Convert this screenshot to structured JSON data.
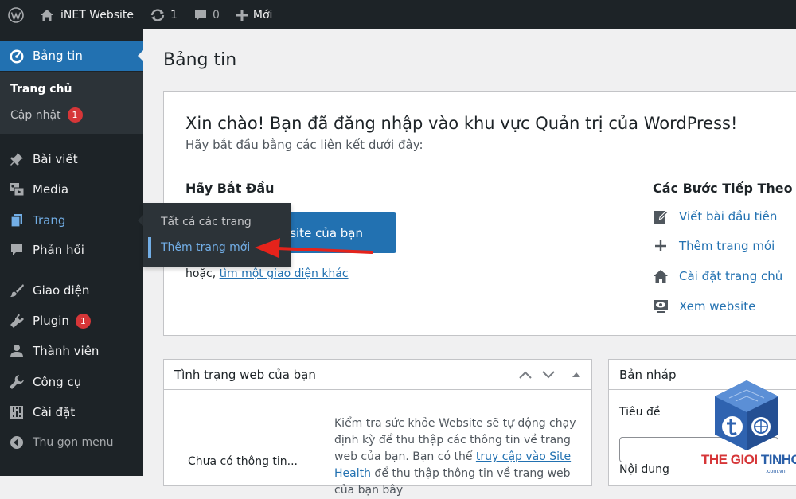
{
  "admin_bar": {
    "site_name": "iNET Website",
    "updates_count": "1",
    "comments_count": "0",
    "new_label": "Mới",
    "icons": [
      "wordpress-logo-icon",
      "home-icon",
      "refresh-icon",
      "comment-icon",
      "plus-icon"
    ]
  },
  "sidebar": {
    "dashboard": "Bảng tin",
    "submenu": {
      "home": "Trang chủ",
      "updates": "Cập nhật",
      "updates_badge": "1"
    },
    "items": [
      {
        "label": "Bài viết",
        "icon": "pin-icon"
      },
      {
        "label": "Media",
        "icon": "media-icon"
      },
      {
        "label": "Trang",
        "icon": "pages-icon"
      },
      {
        "label": "Phản hồi",
        "icon": "comment-icon"
      },
      {
        "label": "Giao diện",
        "icon": "brush-icon"
      },
      {
        "label": "Plugin",
        "icon": "plugin-icon",
        "badge": "1"
      },
      {
        "label": "Thành viên",
        "icon": "user-icon"
      },
      {
        "label": "Công cụ",
        "icon": "wrench-icon"
      },
      {
        "label": "Cài đặt",
        "icon": "settings-icon"
      }
    ],
    "collapse": "Thu gọn menu"
  },
  "flyout": {
    "all_pages": "Tất cả các trang",
    "add_new": "Thêm trang mới"
  },
  "page": {
    "title": "Bảng tin"
  },
  "welcome": {
    "heading": "Xin chào! Bạn đã đăng nhập vào khu vực Quản trị của WordPress!",
    "subheading": "Hãy bắt đầu bằng các liên kết dưới đây:",
    "get_started_heading": "Hãy Bắt Đầu",
    "primary_button": "ebsite của bạn",
    "or_text": "hoặc, ",
    "theme_link": "tìm một giao diện khác",
    "next_steps_heading": "Các Bước Tiếp Theo",
    "next_steps": [
      {
        "label": "Viết bài đầu tiên",
        "icon": "edit-icon"
      },
      {
        "label": "Thêm trang mới",
        "icon": "plus-icon"
      },
      {
        "label": "Cài đặt trang chủ",
        "icon": "home-icon"
      },
      {
        "label": "Xem website",
        "icon": "view-icon"
      }
    ]
  },
  "site_health": {
    "title": "Tình trạng web của bạn",
    "status": "Chưa có thông tin...",
    "desc_1": "Kiểm tra sức khỏe Website sẽ tự động chạy định kỳ để thu thập các thông tin về trang web của bạn. Bạn có thể ",
    "link": "truy cập vào Site Health",
    "desc_2": " để thu thập thông tin về trang web của bạn bây"
  },
  "quick_draft": {
    "title": "Bản nháp",
    "title_label": "Tiêu đề",
    "content_label": "Nội dung"
  },
  "watermark": {
    "brand_1": "THE GIOI",
    "brand_2": " TINHOC",
    "domain": ".com.vn"
  },
  "colors": {
    "accent": "#2271b1",
    "sidebar": "#1d2327",
    "submenu": "#2c3338",
    "badge": "#d63638",
    "arrow": "#e5231b"
  }
}
